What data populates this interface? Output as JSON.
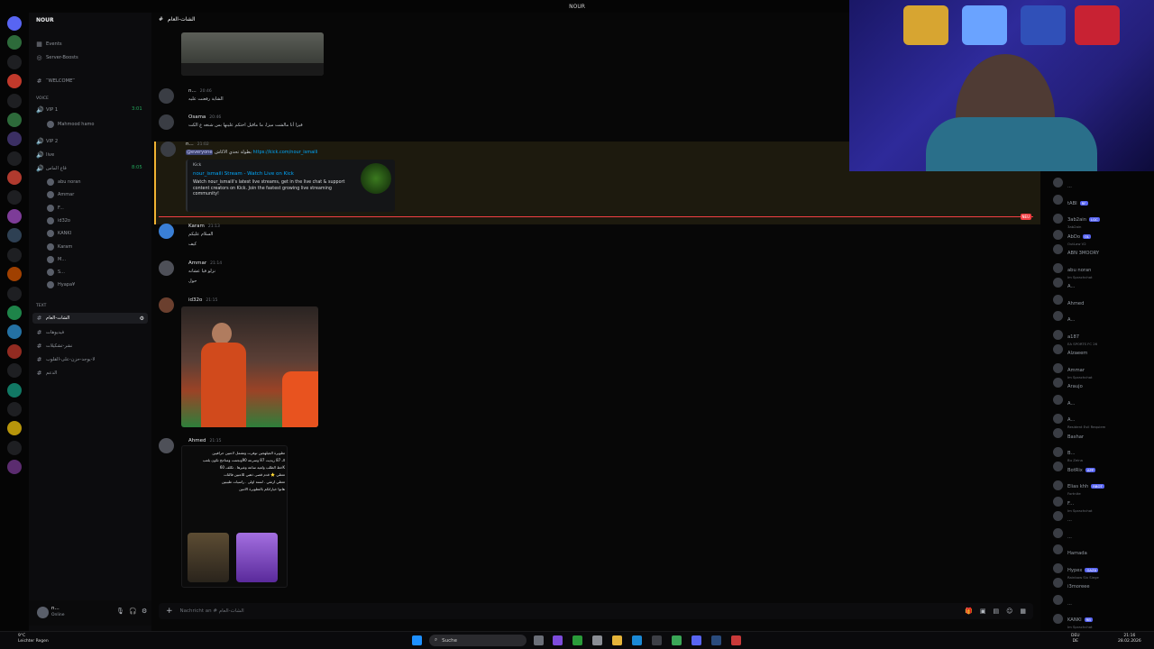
{
  "window": {
    "title": "NOUR"
  },
  "server": {
    "name": "NOUR",
    "icons_count": 24
  },
  "sidebar": {
    "top_items": [
      {
        "label": "Events"
      },
      {
        "label": "Server-Boosts"
      }
    ],
    "welcome": "‾WELCOME‾",
    "voice_category": "VOICE",
    "voice_channels": [
      {
        "label": "VIP 1",
        "timer": "3:01",
        "users": [
          "Mahmood hamo"
        ]
      },
      {
        "label": "VIP 2",
        "users": []
      },
      {
        "label": "live",
        "users": []
      },
      {
        "label": "قاع الماس",
        "timer": "8:05",
        "users": [
          "abu noran",
          "Ammar",
          "F...",
          "id32o",
          "KANKI",
          "Karam",
          "M...",
          "S...",
          "Hyapa¥"
        ]
      }
    ],
    "text_category": "TEXT",
    "text_channels": [
      {
        "label": "الشات-العام",
        "active": true
      },
      {
        "label": "فيديوهات"
      },
      {
        "label": "نشر-تشكيلات"
      },
      {
        "label": "لا-يوجد-حزن-على-القلوب"
      },
      {
        "label": "الدعم"
      }
    ]
  },
  "user": {
    "name": "n...",
    "status": "Online"
  },
  "channel": {
    "name": "الشات-العام"
  },
  "messages": [
    {
      "author": "n...",
      "time": "20:46",
      "lines": [
        "الشاية رفعنت عليه"
      ]
    },
    {
      "author": "Osama",
      "time": "20:46",
      "lines": [
        "فيزا أنا مالشت ميزا، ما ماقيل اختكم علينها بس شنغه ع الكت"
      ]
    },
    {
      "author": "n...",
      "time": "21:02",
      "mention": "@everyone",
      "lines": [
        "بطولة تحدي الاكاش"
      ],
      "link": "https://kick.com/nour_ismaili",
      "embed": {
        "provider": "Kick",
        "title": "nour_ismaili Stream - Watch Live on Kick",
        "description": "Watch nour_ismaili's latest live streams, get in the live chat & support content creators on Kick. Join the fastest growing live streaming community!"
      }
    },
    {
      "author": "Karam",
      "time": "21:13",
      "lines": [
        "السلام عليكم",
        "كيف"
      ]
    },
    {
      "author": "Ammar",
      "time": "21:14",
      "lines": [
        "نزلو فيا عشانه",
        "حول"
      ]
    },
    {
      "author": "id32o",
      "time": "21:15",
      "lines": []
    },
    {
      "author": "Ahmed",
      "time": "21:15",
      "lines": [
        "تطويرة الجيلهجين توفرت وتشمل لاعبين حرافيين",
        "الـ 87 ريديت 87 وسرعه 90ونجمت ومتاحح تكون بلعب",
        "خط الطلب ولعيه ساعة وغيرها . تكلف 60K",
        "تعطي ⭐ قدم قصى ذهبي للاعبين فالثات",
        "تعطي ارتفي . لسنة اولى . راسيات طبيبين",
        "هاتوا خياراتكم بالتطويرة الاثنين"
      ]
    }
  ],
  "new_marker": "NEU",
  "composer": {
    "placeholder": "Nachricht an #"
  },
  "members": [
    {
      "name": "..."
    },
    {
      "name": "tABI",
      "tag": "RF"
    },
    {
      "name": "3ab2ain",
      "tag": "LGC",
      "sub": "3ab2ain"
    },
    {
      "name": "AbDo",
      "tag": "OL",
      "sub": "OutLaw V2"
    },
    {
      "name": "ABN 3MOORY"
    },
    {
      "name": "abu noran",
      "sub": "Im Sprachchat"
    },
    {
      "name": "A..."
    },
    {
      "name": "Ahmed"
    },
    {
      "name": "A..."
    },
    {
      "name": "a187",
      "sub": "EA SPORTS FC 26"
    },
    {
      "name": "Alzaeem"
    },
    {
      "name": "Ammar",
      "sub": "Im Sprachchat"
    },
    {
      "name": "Araujo"
    },
    {
      "name": "A..."
    },
    {
      "name": "A...",
      "sub": "Resident Evil Requiem"
    },
    {
      "name": "Bashar"
    },
    {
      "name": "B...",
      "sub": "Bu Zeina"
    },
    {
      "name": "BotRix",
      "tag": "APP"
    },
    {
      "name": "Elias khh",
      "tag": "RBOT",
      "sub": "Fortnite"
    },
    {
      "name": "F...",
      "sub": "Im Sprachchat"
    },
    {
      "name": "..."
    },
    {
      "name": "..."
    },
    {
      "name": "Hamada"
    },
    {
      "name": "Hypex",
      "tag": "GAZA",
      "sub": "Rainbow Six Siege"
    },
    {
      "name": "i3moreee"
    },
    {
      "name": "..."
    },
    {
      "name": "KANKI",
      "tag": "RB",
      "sub": "Im Sprachchat"
    }
  ],
  "taskbar": {
    "weather_temp": "9°C",
    "weather_desc": "Leichter Regen",
    "search": "Suche",
    "lang": "DEU",
    "region": "DE",
    "time": "21:16",
    "date": "28.02.2026"
  },
  "colors": {
    "accent": "#5865f2",
    "mention_bg": "#1d1a0e",
    "mention_border": "#f0b232",
    "new_line": "#f23f43",
    "online": "#23a55a"
  }
}
